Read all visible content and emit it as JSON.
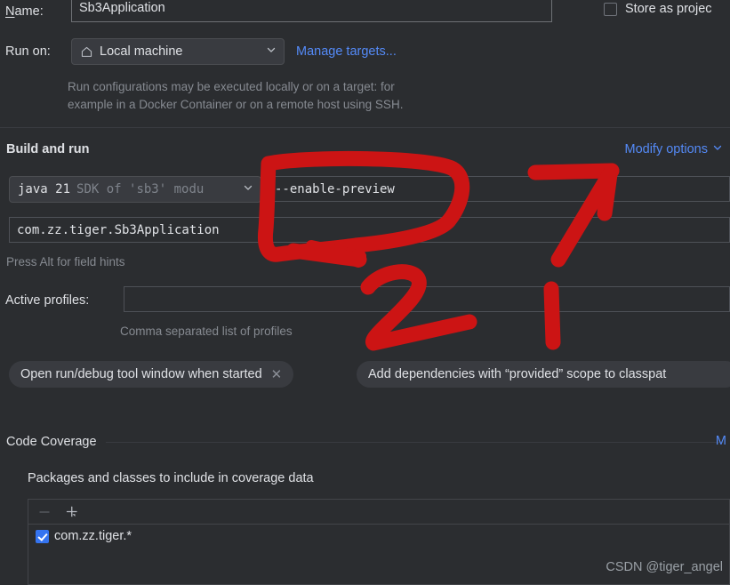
{
  "form": {
    "name_label": "Name:",
    "name_label_mnemonic": "N",
    "name_value": "Sb3Application",
    "store_as_project_label": "Store as projec",
    "run_on_label": "Run on:",
    "run_on_value": "Local machine",
    "run_on_icon": "home-icon",
    "manage_targets_link": "Manage targets...",
    "run_on_hint_line1": "Run configurations may be executed locally or on a target: for",
    "run_on_hint_line2": "example in a Docker Container or on a remote host using SSH."
  },
  "build_and_run": {
    "section_title": "Build and run",
    "modify_options_link": "Modify options",
    "modify_options_caret": "chevron-down-icon",
    "sdk_value_main": "java 21",
    "sdk_value_secondary": "SDK of 'sb3' modu",
    "vm_options_value": "--enable-preview",
    "main_class_value": "com.zz.tiger.Sb3Application",
    "field_hint": "Press Alt for field hints"
  },
  "active_profiles": {
    "label": "Active profiles:",
    "value": "",
    "hint": "Comma separated list of profiles"
  },
  "chips": [
    {
      "label": "Open run/debug tool window when started",
      "closable": true
    },
    {
      "label": "Add dependencies with “provided” scope to classpat",
      "closable": false
    }
  ],
  "code_coverage": {
    "section_title": "Code Coverage",
    "modify_link": "M",
    "packages_label": "Packages and classes to include in coverage data",
    "toolbar": {
      "remove_icon": "minus-icon",
      "add_icon": "plus-icon"
    },
    "items": [
      {
        "label": "com.zz.tiger.*",
        "checked": true
      }
    ]
  },
  "annotations": {
    "marker_one": "1",
    "marker_two": "2",
    "color": "#cc1414"
  },
  "watermark": "CSDN @tiger_angel",
  "colors": {
    "background": "#2b2d30",
    "field_border": "#4e5157",
    "link": "#548af7",
    "accent_checkbox": "#3574f0",
    "annotation_red": "#cc1414",
    "text": "#dfe1e5",
    "muted_text": "#868a91"
  }
}
